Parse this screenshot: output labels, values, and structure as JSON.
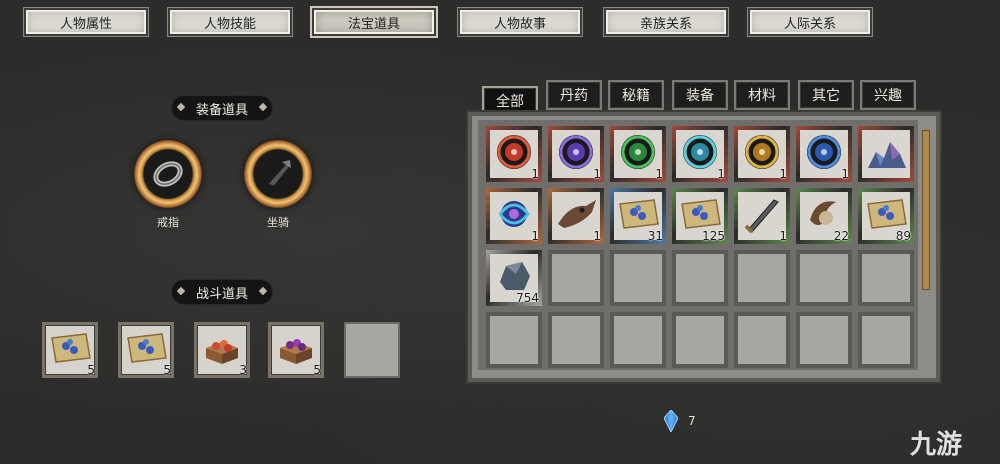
{
  "top_tabs": [
    {
      "label": "人物属性"
    },
    {
      "label": "人物技能"
    },
    {
      "label": "法宝道具",
      "active": true
    },
    {
      "label": "人物故事"
    },
    {
      "label": "亲族关系"
    },
    {
      "label": "人际关系"
    }
  ],
  "equipped": {
    "title": "装备道具",
    "slots": [
      {
        "label": "戒指",
        "icon": "ring-icon"
      },
      {
        "label": "坐骑",
        "icon": "mount-icon"
      }
    ]
  },
  "battle": {
    "title": "战斗道具",
    "slots": [
      {
        "qty": "5",
        "icon": "scroll-map-icon",
        "frame": "#8a6a8f"
      },
      {
        "qty": "5",
        "icon": "scroll-map-icon",
        "frame": "#8a6a8f"
      },
      {
        "qty": "3",
        "icon": "food-box-icon",
        "frame": "#5a85a8"
      },
      {
        "qty": "5",
        "icon": "grape-box-icon",
        "frame": "#6c8a5a"
      },
      {
        "qty": "",
        "icon": "empty-slot",
        "frame": ""
      }
    ]
  },
  "inventory": {
    "categories": [
      {
        "label": "全部",
        "active": true
      },
      {
        "label": "丹药"
      },
      {
        "label": "秘籍"
      },
      {
        "label": "装备"
      },
      {
        "label": "材料"
      },
      {
        "label": "其它"
      },
      {
        "label": "兴趣"
      }
    ],
    "items": [
      {
        "qty": "1",
        "icon": "red-orb-icon",
        "frame": "#a24a3c"
      },
      {
        "qty": "1",
        "icon": "purple-orb-icon",
        "frame": "#a24a3c"
      },
      {
        "qty": "1",
        "icon": "green-orb-icon",
        "frame": "#a24a3c"
      },
      {
        "qty": "1",
        "icon": "cyan-orb-icon",
        "frame": "#a24a3c"
      },
      {
        "qty": "1",
        "icon": "gold-orb-icon",
        "frame": "#a24a3c"
      },
      {
        "qty": "1",
        "icon": "blue-orb-icon",
        "frame": "#a24a3c"
      },
      {
        "qty": "",
        "icon": "ore-pile-icon",
        "frame": "#a24a3c"
      },
      {
        "qty": "1",
        "icon": "spirit-orb-icon",
        "frame": "#b06a3c"
      },
      {
        "qty": "1",
        "icon": "beast-skull-icon",
        "frame": "#b06a3c"
      },
      {
        "qty": "31",
        "icon": "scroll-map-icon",
        "frame": "#4a7aa8"
      },
      {
        "qty": "125",
        "icon": "scroll-map-icon",
        "frame": "#5e8a4e"
      },
      {
        "qty": "1",
        "icon": "sword-icon",
        "frame": "#5e8a4e"
      },
      {
        "qty": "22",
        "icon": "horn-icon",
        "frame": "#5e8a4e"
      },
      {
        "qty": "89",
        "icon": "scroll-map-icon",
        "frame": "#5e8a4e"
      },
      {
        "qty": "754",
        "icon": "stone-icon",
        "frame": "#a6a49e"
      }
    ],
    "total_cells": 28
  },
  "currency": {
    "icon": "blue-gem-icon",
    "count": "7"
  },
  "watermark": "九游",
  "colors": {
    "accent_gold": "#c48a3a",
    "panel": "#8e8c86",
    "frame_red": "#a24a3c",
    "frame_green": "#5e8a4e",
    "frame_blue": "#4a7aa8"
  }
}
